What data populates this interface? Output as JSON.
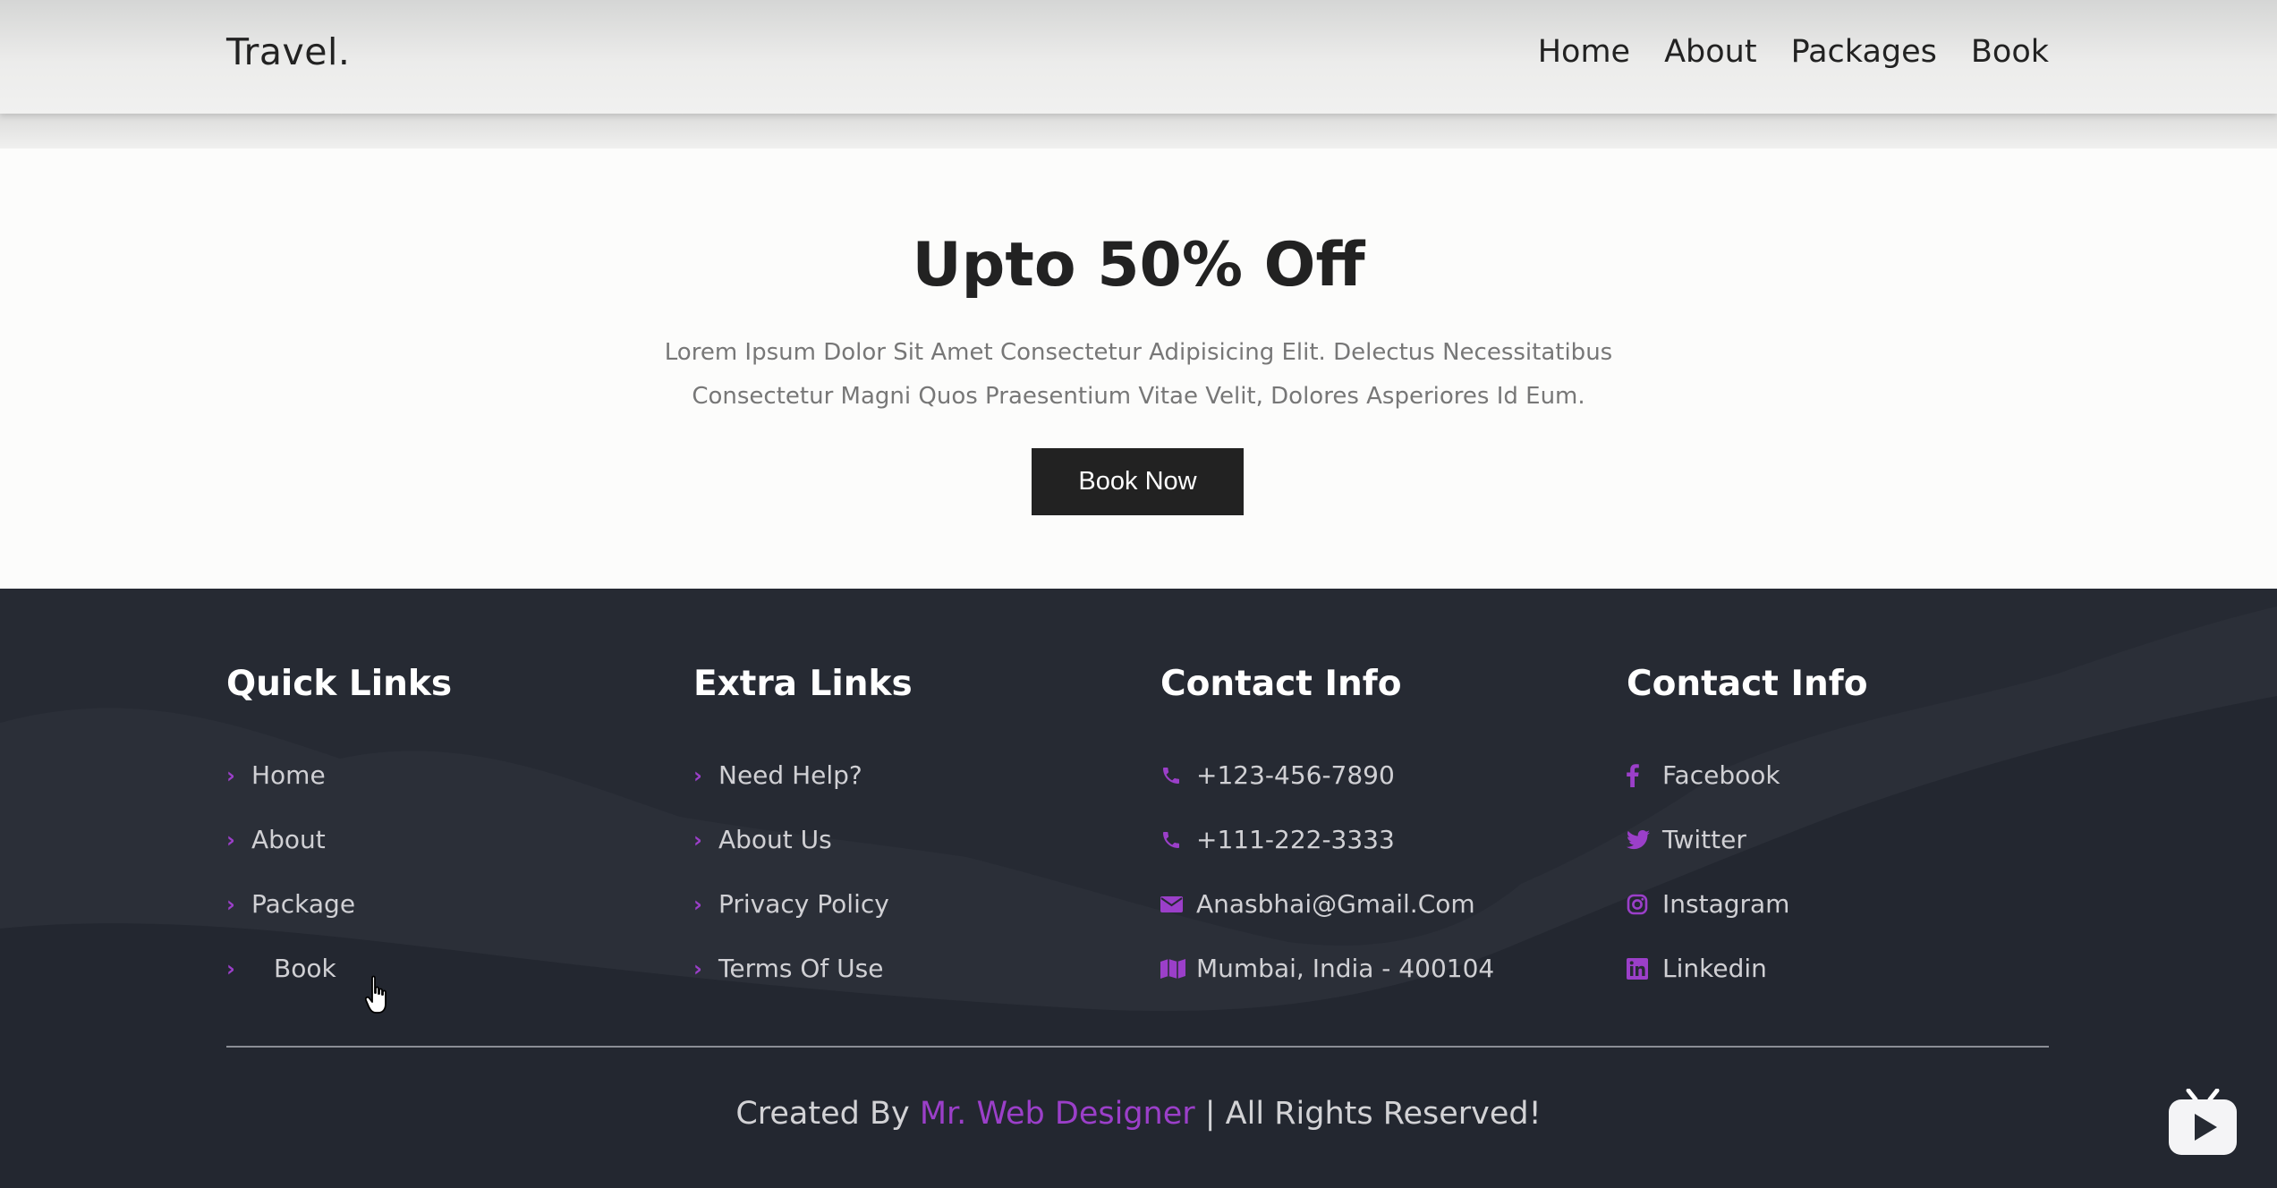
{
  "nav": {
    "logo": "Travel.",
    "links": [
      "Home",
      "About",
      "Packages",
      "Book"
    ]
  },
  "hero": {
    "title": "Upto 50% Off",
    "description_line1": "Lorem Ipsum Dolor Sit Amet Consectetur Adipisicing Elit. Delectus Necessitatibus",
    "description_line2": "Consectetur Magni Quos Praesentium Vitae Velit, Dolores Asperiores Id Eum.",
    "button_label": "Book Now"
  },
  "footer": {
    "quick_links": {
      "title": "Quick Links",
      "items": [
        "Home",
        "About",
        "Package",
        "Book"
      ]
    },
    "extra_links": {
      "title": "Extra Links",
      "items": [
        "Need Help?",
        "About Us",
        "Privacy Policy",
        "Terms Of Use"
      ]
    },
    "contact_info": {
      "title": "Contact Info",
      "items": [
        {
          "icon": "phone-icon",
          "text": "+123-456-7890"
        },
        {
          "icon": "phone-icon",
          "text": "+111-222-3333"
        },
        {
          "icon": "envelope-icon",
          "text": "Anasbhai@Gmail.Com"
        },
        {
          "icon": "map-icon",
          "text": "Mumbai, India - 400104"
        }
      ]
    },
    "social": {
      "title": "Contact Info",
      "items": [
        {
          "icon": "facebook-icon",
          "text": "Facebook"
        },
        {
          "icon": "twitter-icon",
          "text": "Twitter"
        },
        {
          "icon": "instagram-icon",
          "text": "Instagram"
        },
        {
          "icon": "linkedin-icon",
          "text": "Linkedin"
        }
      ]
    },
    "credit": {
      "prefix": "Created By ",
      "author": "Mr. Web Designer",
      "suffix": " | All Rights Reserved!"
    }
  },
  "colors": {
    "accent": "#9b3fc9",
    "footer_bg": "#262a33",
    "button_bg": "#222222"
  }
}
